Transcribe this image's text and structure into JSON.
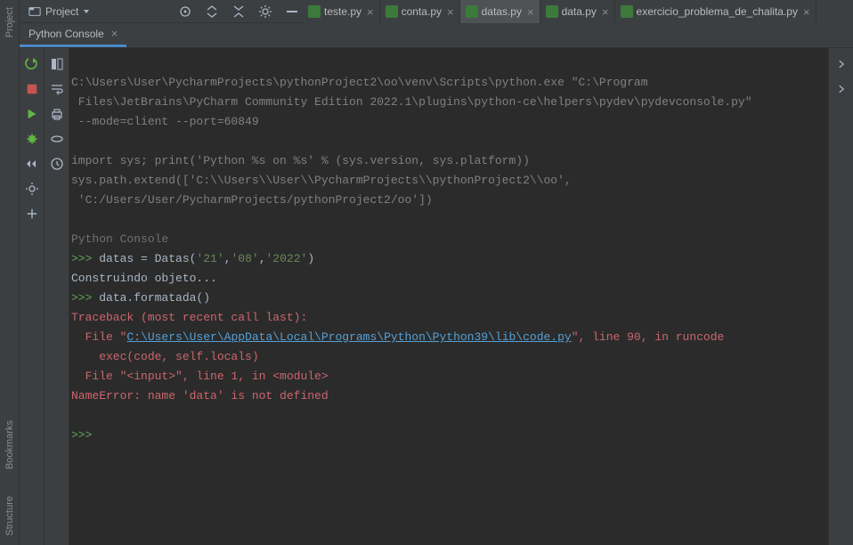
{
  "project": {
    "label": "Project"
  },
  "editor_tabs": [
    {
      "label": "teste.py",
      "active": false
    },
    {
      "label": "conta.py",
      "active": false
    },
    {
      "label": "datas.py",
      "active": true
    },
    {
      "label": "data.py",
      "active": false
    },
    {
      "label": "exercicio_problema_de_chalita.py",
      "active": false
    }
  ],
  "console_tab": "Python Console",
  "gutter": {
    "project": "Project",
    "bookmarks": "Bookmarks",
    "structure": "Structure"
  },
  "console": {
    "line1": "C:\\Users\\User\\PycharmProjects\\pythonProject2\\oo\\venv\\Scripts\\python.exe \"C:\\Program",
    "line2": " Files\\JetBrains\\PyCharm Community Edition 2022.1\\plugins\\python-ce\\helpers\\pydev\\pydevconsole.py\"",
    "line3": " --mode=client --port=60849",
    "line4": "import sys; print('Python %s on %s' % (sys.version, sys.platform))",
    "line5": "sys.path.extend(['C:\\\\Users\\\\User\\\\PycharmProjects\\\\pythonProject2\\\\oo',",
    "line6": " 'C:/Users/User/PycharmProjects/pythonProject2/oo'])",
    "header": "Python Console",
    "prompt": ">>> ",
    "cmd1a": "datas = Datas(",
    "cmd1_s1": "'21'",
    "cmd1_c1": ",",
    "cmd1_s2": "'08'",
    "cmd1_c2": ",",
    "cmd1_s3": "'2022'",
    "cmd1b": ")",
    "out1": "Construindo objeto...",
    "cmd2": "data.formatada()",
    "tb1": "Traceback (most recent call last):",
    "tb2a": "  File \"",
    "tb2_link": "C:\\Users\\User\\AppData\\Local\\Programs\\Python\\Python39\\lib\\code.py",
    "tb2b": "\", line 90, in runcode",
    "tb3": "    exec(code, self.locals)",
    "tb4": "  File \"<input>\", line 1, in <module>",
    "tb5": "NameError: name 'data' is not defined"
  }
}
